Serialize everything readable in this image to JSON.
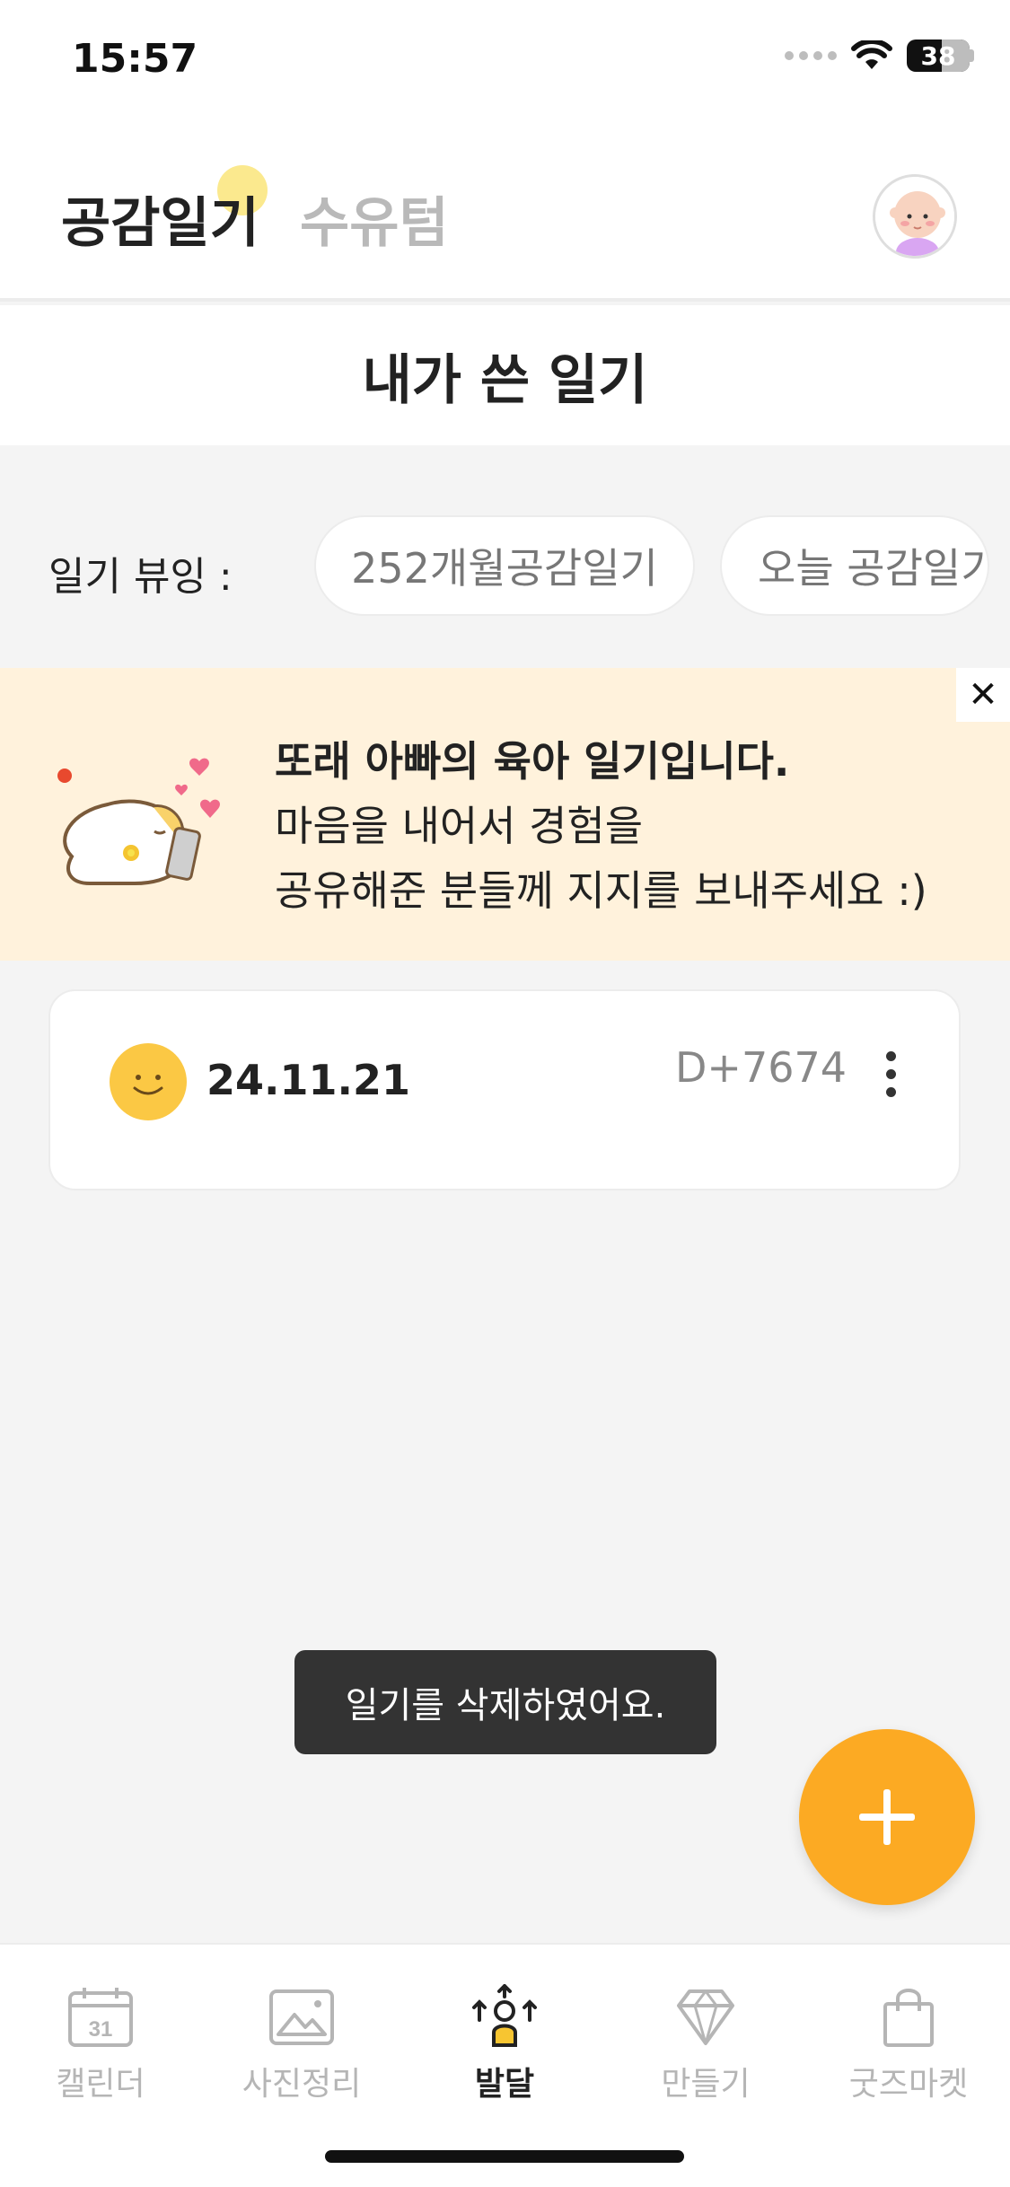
{
  "status_bar": {
    "time": "15:57",
    "battery": "38",
    "icons": [
      "signal-icon",
      "wifi-icon",
      "battery-icon"
    ]
  },
  "header": {
    "tab_active": "공감일기",
    "tab_inactive": "수유텀",
    "avatar_icon": "baby-avatar-icon"
  },
  "section": {
    "title": "내가 쓴 일기"
  },
  "filter": {
    "label": "일기 뷰잉 :",
    "chips": [
      "252개월공감일기",
      "오늘 공감일기"
    ]
  },
  "banner": {
    "line1": "또래 아빠의 육아 일기입니다.",
    "line2": "마음을 내어서 경험을",
    "line3": "공유해준 분들께 지지를 보내주세요 :)",
    "close_label": "✕",
    "illustration": "baby-with-phone-illustration"
  },
  "diary_card": {
    "emoji": "smile-face-icon",
    "date": "24.11.21",
    "dday": "D+7674",
    "more_icon": "more-vertical-icon"
  },
  "toast": {
    "message": "일기를 삭제하였어요."
  },
  "fab": {
    "icon": "plus-icon"
  },
  "bottom_nav": {
    "items": [
      {
        "label": "캘린더",
        "icon": "calendar-icon",
        "calendar_number": "31"
      },
      {
        "label": "사진정리",
        "icon": "photo-icon"
      },
      {
        "label": "발달",
        "icon": "growth-person-icon"
      },
      {
        "label": "만들기",
        "icon": "diamond-icon"
      },
      {
        "label": "굿즈마켓",
        "icon": "shopping-bag-icon"
      }
    ],
    "active_index": 2
  },
  "colors": {
    "accent": "#fcaa23",
    "banner_bg": "#fff2dc",
    "header_dot": "#fbe98e",
    "toast_bg": "#333333",
    "inactive_text": "#b5b5b5"
  }
}
